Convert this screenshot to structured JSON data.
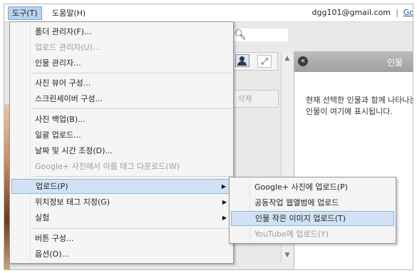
{
  "menubar": {
    "tools": "도구(T)",
    "help": "도움말(H)",
    "account": "dgg101@gmail.com",
    "separator": "|",
    "go_link": "Go"
  },
  "background": {
    "delete_button": "삭제",
    "side_panel_title": "인물",
    "side_panel_message": "현재 선택한 인물과 함께 나타나는 인물이 여기에 표시됩니다."
  },
  "tools_menu": {
    "items": [
      {
        "label": "폴더 관리자(F)...",
        "enabled": true
      },
      {
        "label": "업로드 관리자(U)...",
        "enabled": false
      },
      {
        "label": "인물 관리자...",
        "enabled": true
      },
      {
        "label": "사진 뷰어 구성...",
        "enabled": true
      },
      {
        "label": "스크린세이버 구성...",
        "enabled": true
      },
      {
        "label": "사진 백업(B)...",
        "enabled": true
      },
      {
        "label": "일괄 업로드...",
        "enabled": true
      },
      {
        "label": "날짜 및 시간 조정(D)...",
        "enabled": true
      },
      {
        "label": "Google+ 사진에서 이름 태그 다운로드(W)",
        "enabled": false
      },
      {
        "label": "업로드(P)",
        "enabled": true,
        "submenu": true,
        "highlighted": true
      },
      {
        "label": "위치정보 태그 지정(G)",
        "enabled": true,
        "submenu": true
      },
      {
        "label": "실험",
        "enabled": true,
        "submenu": true
      },
      {
        "label": "버튼 구성...",
        "enabled": true
      },
      {
        "label": "옵션(O)...",
        "enabled": true
      }
    ]
  },
  "upload_submenu": {
    "items": [
      {
        "label": "Google+ 사진에 업로드(P)",
        "enabled": true
      },
      {
        "label": "공동작업 웹앨범에 업로드",
        "enabled": true
      },
      {
        "label": "인물 작은 이미지 업로드(T)",
        "enabled": true,
        "highlighted": true
      },
      {
        "label": "YouTube에 업로드(Y)",
        "enabled": false
      }
    ]
  },
  "icons": {
    "submenu_arrow": "▶",
    "search": "search-icon",
    "person": "person-icon",
    "expand": "expand-icon",
    "collapse": "collapse-icon"
  },
  "colors": {
    "highlight": "#d1e2f4",
    "highlight_border": "#8fb3dd",
    "disabled_text": "#9c9c9c",
    "link": "#1a4fa0"
  }
}
